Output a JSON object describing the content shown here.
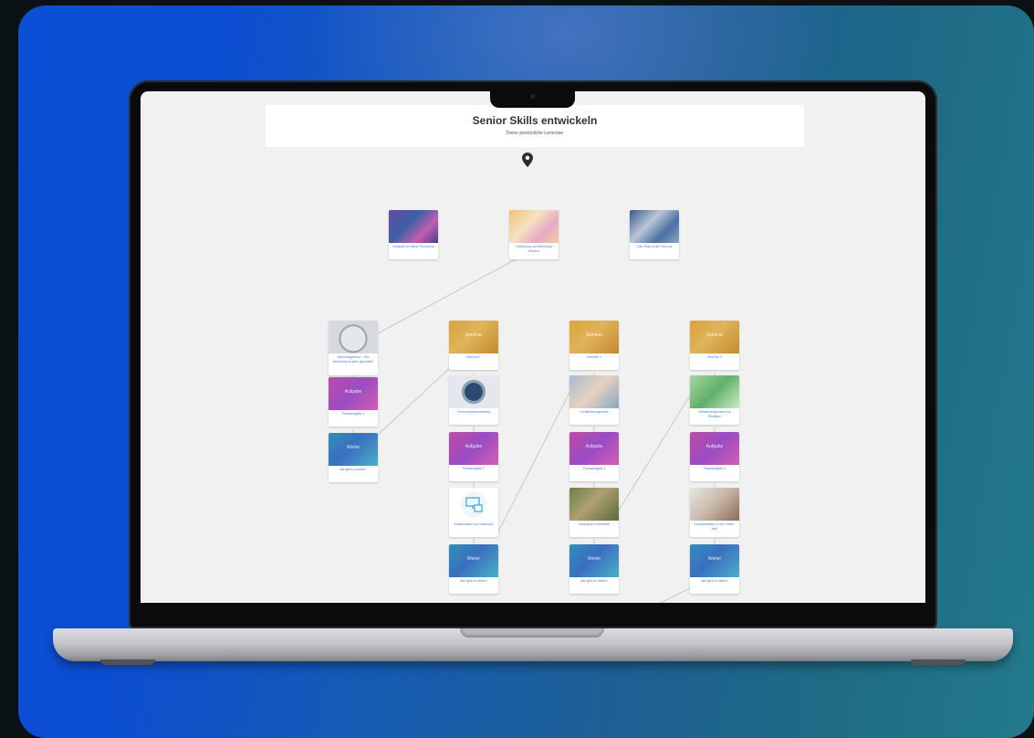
{
  "page": {
    "title": "Senior Skills entwickeln",
    "subtitle": "Deine persönliche Lernreise"
  },
  "icons": {
    "pin": "map-pin-icon"
  },
  "colors": {
    "caption": "#4a7fd0",
    "background_start": "#0b4fd6",
    "background_end": "#237a8c"
  },
  "cards": [
    {
      "id": "c1",
      "caption": "Kickstart mit deiner Peergroup",
      "overlay": ""
    },
    {
      "id": "c2",
      "caption": "Einführung und Mentoring Session",
      "overlay": ""
    },
    {
      "id": "c3",
      "caption": "Dein Start in die Führung",
      "overlay": ""
    },
    {
      "id": "c4",
      "caption": "Zeitmanagement – Wie bekomme ich alles geschafft?",
      "overlay": ""
    },
    {
      "id": "c5",
      "caption": "Praxisaufgabe 1",
      "overlay": "Aufgabe"
    },
    {
      "id": "c6",
      "caption": "Wie geht es weiter?",
      "overlay": "Weiter"
    },
    {
      "id": "c7",
      "caption": "Seminar 1",
      "overlay": "Seminar"
    },
    {
      "id": "c8",
      "caption": "Kommunikationstraining",
      "overlay": ""
    },
    {
      "id": "c9",
      "caption": "Praxisaufgabe 2",
      "overlay": "Aufgabe"
    },
    {
      "id": "c10",
      "caption": "Kollaboration und Teamwork",
      "overlay": ""
    },
    {
      "id": "c11",
      "caption": "Wie geht es weiter?",
      "overlay": "Weiter"
    },
    {
      "id": "c12",
      "caption": "Seminar 2",
      "overlay": "Seminar"
    },
    {
      "id": "c13",
      "caption": "Konfliktmanagement",
      "overlay": ""
    },
    {
      "id": "c14",
      "caption": "Praxisaufgabe 3",
      "overlay": "Aufgabe"
    },
    {
      "id": "c15",
      "caption": "Gespräche vorbereiten",
      "overlay": ""
    },
    {
      "id": "c16",
      "caption": "Wie geht es weiter?",
      "overlay": "Weiter"
    },
    {
      "id": "c17",
      "caption": "Seminar 3",
      "overlay": "Seminar"
    },
    {
      "id": "c18",
      "caption": "Selbstmanagement und Resilienz",
      "overlay": ""
    },
    {
      "id": "c19",
      "caption": "Praxisaufgabe 4",
      "overlay": "Aufgabe"
    },
    {
      "id": "c20",
      "caption": "Kommunikation in der Online-Welt",
      "overlay": ""
    },
    {
      "id": "c21",
      "caption": "Wie geht es weiter?",
      "overlay": "Weiter"
    }
  ]
}
